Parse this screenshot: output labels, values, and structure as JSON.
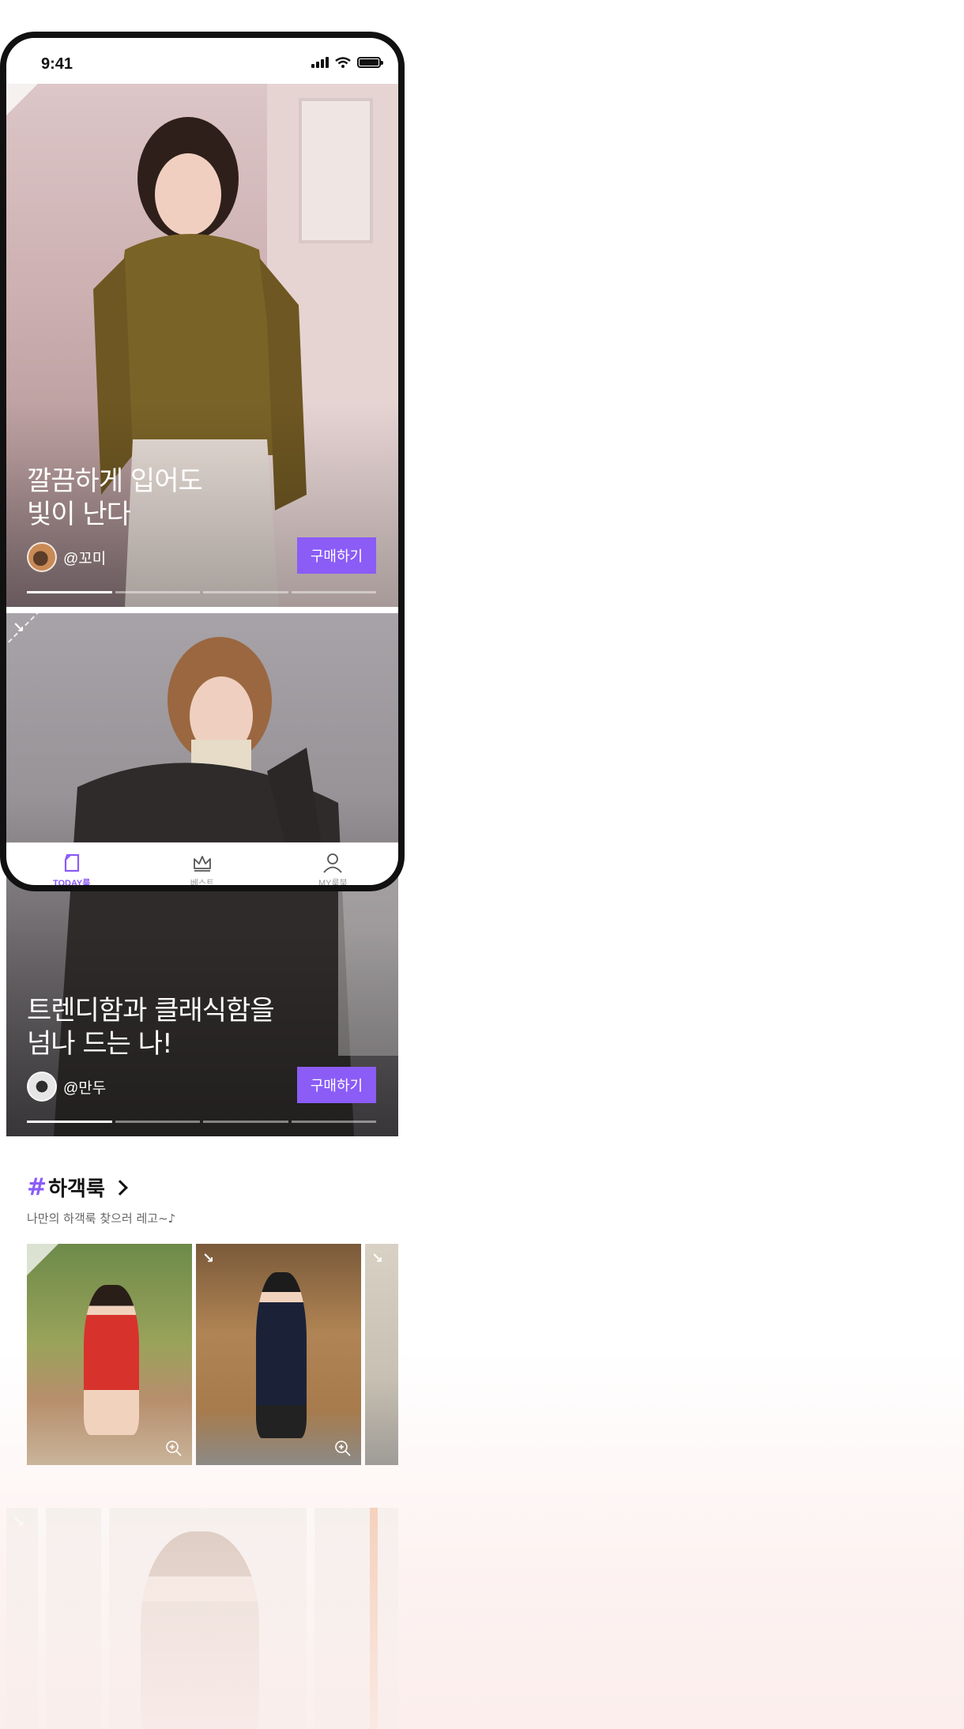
{
  "status_bar": {
    "time": "9:41"
  },
  "feed": [
    {
      "headline": "깔끔하게 입어도\n빛이 난다",
      "author": "@꼬미",
      "buy_label": "구매하기",
      "progress": {
        "segments": 4,
        "active": 1
      }
    },
    {
      "headline": "트렌디함과 클래식함을\n넘나 드는 나!",
      "author": "@만두",
      "buy_label": "구매하기",
      "progress": {
        "segments": 4,
        "active": 1
      }
    }
  ],
  "tabbar": {
    "items": [
      {
        "label": "TODAY룩",
        "icon": "page-fold-icon",
        "active": true
      },
      {
        "label": "베스트",
        "icon": "crown-icon",
        "active": false
      },
      {
        "label": "MY룩북",
        "icon": "person-icon",
        "active": false
      }
    ]
  },
  "hashtag_section": {
    "hash": "#",
    "title": "하객룩",
    "subtitle": "나만의 하객룩 찾으러 레고~♪",
    "thumbnails": [
      {
        "icon": "zoom-in-icon"
      },
      {
        "icon": "zoom-in-icon"
      },
      {
        "icon": "arrow-icon"
      }
    ]
  },
  "colors": {
    "accent": "#8b5cf6",
    "frame": "#111111",
    "tab_inactive": "#999999"
  }
}
